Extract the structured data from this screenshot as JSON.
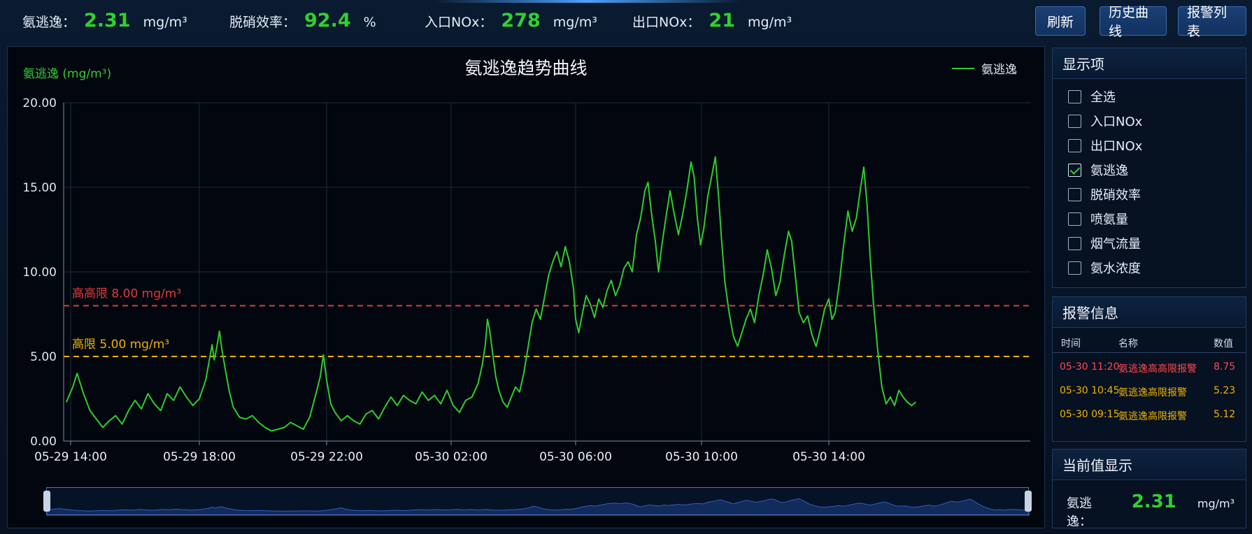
{
  "header": {
    "metrics": [
      {
        "label": "氨逃逸：",
        "value": "2.31",
        "unit": "mg/m³"
      },
      {
        "label": "脱硝效率：",
        "value": "92.4",
        "unit": "%"
      },
      {
        "label": "入口NOx：",
        "value": "278",
        "unit": "mg/m³"
      },
      {
        "label": "出口NOx：",
        "value": "21",
        "unit": "mg/m³"
      }
    ],
    "buttons": {
      "refresh": "刷新",
      "history": "历史曲线",
      "alarm_list": "报警列表"
    }
  },
  "colors": {
    "series": "#2ecc2e",
    "high_high": "#e03a3a",
    "high": "#f0b000",
    "value_green": "#2fd12f"
  },
  "chart_data": {
    "type": "line",
    "title": "氨逃逸趋势曲线",
    "ylabel": "氨逃逸 (mg/m³)",
    "ylim": [
      0,
      20
    ],
    "y_ticks": [
      "0.00",
      "5.00",
      "10.00",
      "15.00",
      "20.00"
    ],
    "x_ticks": [
      "05-29 14:00",
      "05-29 18:00",
      "05-29 22:00",
      "05-30 02:00",
      "05-30 06:00",
      "05-30 10:00",
      "05-30 14:00"
    ],
    "x_tick_hours": [
      0,
      4,
      8,
      12,
      16,
      20,
      24
    ],
    "xlim_hours": [
      -0.2,
      26.5
    ],
    "series": [
      {
        "name": "氨逃逸",
        "points": [
          [
            -0.2,
            2.3
          ],
          [
            0.1,
            3.2
          ],
          [
            0.3,
            4.0
          ],
          [
            0.6,
            2.8
          ],
          [
            0.9,
            1.8
          ],
          [
            1.2,
            1.3
          ],
          [
            1.5,
            0.8
          ],
          [
            1.8,
            1.2
          ],
          [
            2.1,
            1.5
          ],
          [
            2.4,
            1.0
          ],
          [
            2.7,
            1.8
          ],
          [
            3.0,
            2.4
          ],
          [
            3.3,
            1.9
          ],
          [
            3.6,
            2.8
          ],
          [
            3.9,
            2.2
          ],
          [
            4.2,
            1.8
          ],
          [
            4.5,
            2.8
          ],
          [
            4.8,
            2.4
          ],
          [
            5.1,
            3.2
          ],
          [
            5.4,
            2.6
          ],
          [
            5.7,
            2.1
          ],
          [
            6.0,
            2.5
          ],
          [
            6.3,
            3.6
          ],
          [
            6.5,
            5.0
          ],
          [
            6.6,
            5.7
          ],
          [
            6.7,
            4.8
          ],
          [
            6.8,
            5.4
          ],
          [
            6.95,
            6.5
          ],
          [
            7.05,
            5.5
          ],
          [
            7.2,
            4.4
          ],
          [
            7.4,
            3.0
          ],
          [
            7.6,
            2.0
          ],
          [
            7.9,
            1.4
          ],
          [
            8.2,
            1.3
          ],
          [
            8.5,
            1.5
          ],
          [
            8.8,
            1.1
          ],
          [
            9.1,
            0.8
          ],
          [
            9.4,
            0.6
          ],
          [
            9.7,
            0.7
          ],
          [
            10.0,
            0.8
          ],
          [
            10.3,
            1.1
          ],
          [
            10.6,
            0.9
          ],
          [
            10.9,
            0.7
          ],
          [
            11.2,
            1.4
          ],
          [
            11.5,
            2.8
          ],
          [
            11.7,
            3.8
          ],
          [
            11.85,
            5.1
          ],
          [
            12.0,
            3.6
          ],
          [
            12.2,
            2.2
          ],
          [
            12.4,
            1.7
          ],
          [
            12.7,
            1.2
          ],
          [
            13.0,
            1.5
          ],
          [
            13.3,
            1.2
          ],
          [
            13.6,
            1.0
          ],
          [
            13.9,
            1.6
          ],
          [
            14.2,
            1.8
          ],
          [
            14.5,
            1.3
          ],
          [
            14.8,
            2.0
          ],
          [
            15.1,
            2.6
          ],
          [
            15.4,
            2.1
          ],
          [
            15.7,
            2.7
          ],
          [
            16.0,
            2.4
          ],
          [
            16.3,
            2.2
          ],
          [
            16.6,
            2.9
          ],
          [
            16.9,
            2.4
          ],
          [
            17.2,
            2.7
          ],
          [
            17.5,
            2.2
          ],
          [
            17.8,
            3.0
          ],
          [
            18.1,
            2.1
          ],
          [
            18.4,
            1.7
          ],
          [
            18.7,
            2.4
          ],
          [
            19.0,
            2.6
          ],
          [
            19.3,
            3.4
          ],
          [
            19.5,
            4.5
          ],
          [
            19.65,
            5.7
          ],
          [
            19.75,
            7.2
          ],
          [
            19.85,
            6.6
          ],
          [
            20.0,
            5.2
          ],
          [
            20.15,
            3.8
          ],
          [
            20.3,
            3.0
          ],
          [
            20.5,
            2.3
          ],
          [
            20.7,
            2.0
          ],
          [
            20.9,
            2.6
          ],
          [
            21.1,
            3.2
          ],
          [
            21.3,
            2.9
          ],
          [
            21.5,
            4.0
          ],
          [
            21.7,
            5.5
          ],
          [
            21.9,
            7.0
          ],
          [
            22.1,
            7.8
          ],
          [
            22.3,
            7.2
          ],
          [
            22.5,
            8.5
          ],
          [
            22.7,
            9.8
          ],
          [
            22.9,
            10.6
          ],
          [
            23.1,
            11.2
          ],
          [
            23.3,
            10.3
          ],
          [
            23.5,
            11.5
          ],
          [
            23.7,
            10.6
          ],
          [
            23.9,
            9.0
          ],
          [
            24.0,
            7.2
          ],
          [
            24.15,
            6.4
          ],
          [
            24.3,
            7.4
          ],
          [
            24.5,
            8.6
          ],
          [
            24.7,
            8.1
          ],
          [
            24.9,
            7.3
          ],
          [
            25.1,
            8.4
          ],
          [
            25.3,
            7.9
          ],
          [
            25.5,
            8.9
          ],
          [
            25.7,
            9.5
          ],
          [
            25.9,
            8.6
          ],
          [
            26.1,
            9.2
          ],
          [
            26.3,
            10.2
          ],
          [
            26.5,
            10.6
          ],
          [
            26.7,
            10.0
          ],
          [
            26.9,
            12.2
          ],
          [
            27.1,
            13.2
          ],
          [
            27.3,
            14.8
          ],
          [
            27.45,
            15.3
          ],
          [
            27.6,
            13.6
          ],
          [
            27.8,
            11.8
          ],
          [
            27.95,
            10.0
          ],
          [
            28.1,
            11.5
          ],
          [
            28.3,
            13.2
          ],
          [
            28.5,
            14.8
          ],
          [
            28.7,
            13.4
          ],
          [
            28.9,
            12.2
          ],
          [
            29.1,
            13.4
          ],
          [
            29.3,
            14.8
          ],
          [
            29.5,
            16.5
          ],
          [
            29.65,
            15.6
          ],
          [
            29.8,
            13.2
          ],
          [
            29.95,
            11.6
          ],
          [
            30.1,
            12.5
          ],
          [
            30.3,
            14.5
          ],
          [
            30.5,
            15.8
          ],
          [
            30.65,
            16.8
          ],
          [
            30.8,
            14.5
          ],
          [
            30.95,
            11.8
          ],
          [
            31.1,
            9.4
          ],
          [
            31.3,
            7.6
          ],
          [
            31.5,
            6.2
          ],
          [
            31.7,
            5.6
          ],
          [
            31.9,
            6.4
          ],
          [
            32.1,
            7.2
          ],
          [
            32.3,
            7.8
          ],
          [
            32.5,
            7.0
          ],
          [
            32.7,
            8.6
          ],
          [
            32.9,
            9.8
          ],
          [
            33.1,
            11.3
          ],
          [
            33.3,
            10.2
          ],
          [
            33.5,
            8.6
          ],
          [
            33.7,
            9.4
          ],
          [
            33.9,
            11.0
          ],
          [
            34.1,
            12.4
          ],
          [
            34.25,
            11.8
          ],
          [
            34.45,
            9.4
          ],
          [
            34.6,
            7.6
          ],
          [
            34.8,
            7.0
          ],
          [
            35.0,
            7.4
          ],
          [
            35.2,
            6.3
          ],
          [
            35.4,
            5.6
          ],
          [
            35.6,
            6.6
          ],
          [
            35.8,
            7.8
          ],
          [
            36.0,
            8.4
          ],
          [
            36.15,
            7.2
          ],
          [
            36.3,
            7.6
          ],
          [
            36.5,
            9.4
          ],
          [
            36.7,
            11.6
          ],
          [
            36.9,
            13.6
          ],
          [
            37.1,
            12.4
          ],
          [
            37.3,
            13.2
          ],
          [
            37.5,
            15.0
          ],
          [
            37.65,
            16.2
          ],
          [
            37.8,
            14.0
          ],
          [
            37.95,
            10.8
          ],
          [
            38.1,
            8.2
          ],
          [
            38.3,
            5.4
          ],
          [
            38.5,
            3.2
          ],
          [
            38.7,
            2.2
          ],
          [
            38.9,
            2.6
          ],
          [
            39.1,
            2.1
          ],
          [
            39.3,
            3.0
          ],
          [
            39.5,
            2.6
          ],
          [
            39.7,
            2.3
          ],
          [
            39.9,
            2.1
          ],
          [
            40.1,
            2.3
          ]
        ]
      }
    ],
    "thresholds": [
      {
        "label": "高高限  8.00 mg/m³",
        "value": 8.0,
        "color": "#e03a3a"
      },
      {
        "label": "高限  5.00 mg/m³",
        "value": 5.0,
        "color": "#f0b000"
      }
    ]
  },
  "display_panel": {
    "title": "显示项",
    "items": [
      {
        "label": "全选",
        "checked": false
      },
      {
        "label": "入口NOx",
        "checked": false
      },
      {
        "label": "出口NOx",
        "checked": false
      },
      {
        "label": "氨逃逸",
        "checked": true
      },
      {
        "label": "脱硝效率",
        "checked": false
      },
      {
        "label": "喷氨量",
        "checked": false
      },
      {
        "label": "烟气流量",
        "checked": false
      },
      {
        "label": "氨水浓度",
        "checked": false
      }
    ]
  },
  "alarm_panel": {
    "title": "报警信息",
    "columns": {
      "time": "时间",
      "name": "名称",
      "value": "数值"
    },
    "rows": [
      {
        "time": "05-30 11:20",
        "name": "氨逃逸高高限报警",
        "value": "8.75",
        "color": "#ff4a4a"
      },
      {
        "time": "05-30 10:45",
        "name": "氨逃逸高限报警",
        "value": "5.23",
        "color": "#f0b400"
      },
      {
        "time": "05-30 09:15",
        "name": "氨逃逸高限报警",
        "value": "5.12",
        "color": "#f0b400"
      }
    ]
  },
  "current_panel": {
    "title": "当前值显示",
    "label": "氨逃逸：",
    "value": "2.31",
    "unit": "mg/m³"
  }
}
